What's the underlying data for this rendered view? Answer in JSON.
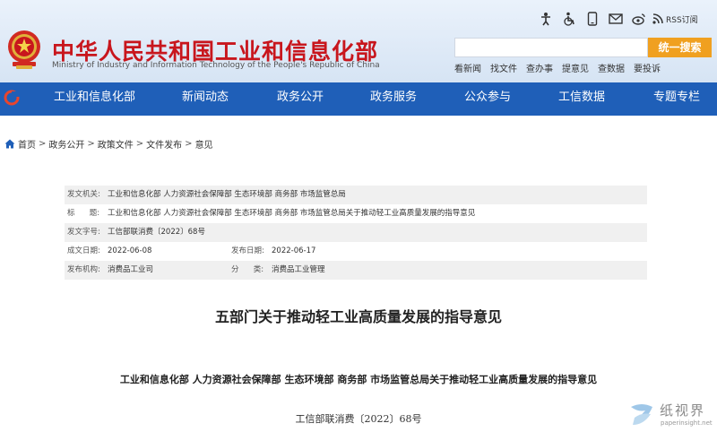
{
  "header": {
    "site_title": "中华人民共和国工业和信息化部",
    "site_subtitle": "Ministry of Industry and Information Technology of the People's Republic of China",
    "top_icons": [
      "accessibility-person-icon",
      "wheelchair-icon",
      "mobile-phone-icon",
      "mail-icon",
      "weibo-icon",
      "rss-icon"
    ],
    "rss_label": "RSS订阅",
    "search": {
      "placeholder": "",
      "button": "统一搜索"
    },
    "quick_links": [
      "看新闻",
      "找文件",
      "查办事",
      "提意见",
      "查数据",
      "要投诉"
    ]
  },
  "nav": {
    "items": [
      "工业和信息化部",
      "新闻动态",
      "政务公开",
      "政务服务",
      "公众参与",
      "工信数据",
      "专题专栏"
    ]
  },
  "breadcrumb": [
    "首页",
    "政务公开",
    "政策文件",
    "文件发布",
    "意见"
  ],
  "meta": {
    "issuer_label": "发文机关:",
    "issuer": "工业和信息化部 人力资源社会保障部 生态环境部 商务部 市场监管总局",
    "title_label": "标      题:",
    "title": "工业和信息化部 人力资源社会保障部 生态环境部 商务部 市场监管总局关于推动轻工业高质量发展的指导意见",
    "docno_label": "发文字号:",
    "docno": "工信部联消费〔2022〕68号",
    "written_label": "成文日期:",
    "written": "2022-06-08",
    "published_label": "发布日期:",
    "published": "2022-06-17",
    "org_label": "发布机构:",
    "org": "消费品工业司",
    "category_label": "分      类:",
    "category": "消费品工业管理"
  },
  "article": {
    "title": "五部门关于推动轻工业高质量发展的指导意见",
    "issuers": "工业和信息化部 人力资源社会保障部 生态环境部 商务部 市场监管总局关于推动轻工业高质量发展的指导意见",
    "docno": "工信部联消费〔2022〕68号"
  },
  "watermark": {
    "cn": "纸视界",
    "url": "paperinsight.net"
  },
  "colors": {
    "nav_blue": "#1f5fb8",
    "title_red": "#c8161d",
    "search_orange": "#f0a020",
    "header_bg": "#e2edf8"
  }
}
